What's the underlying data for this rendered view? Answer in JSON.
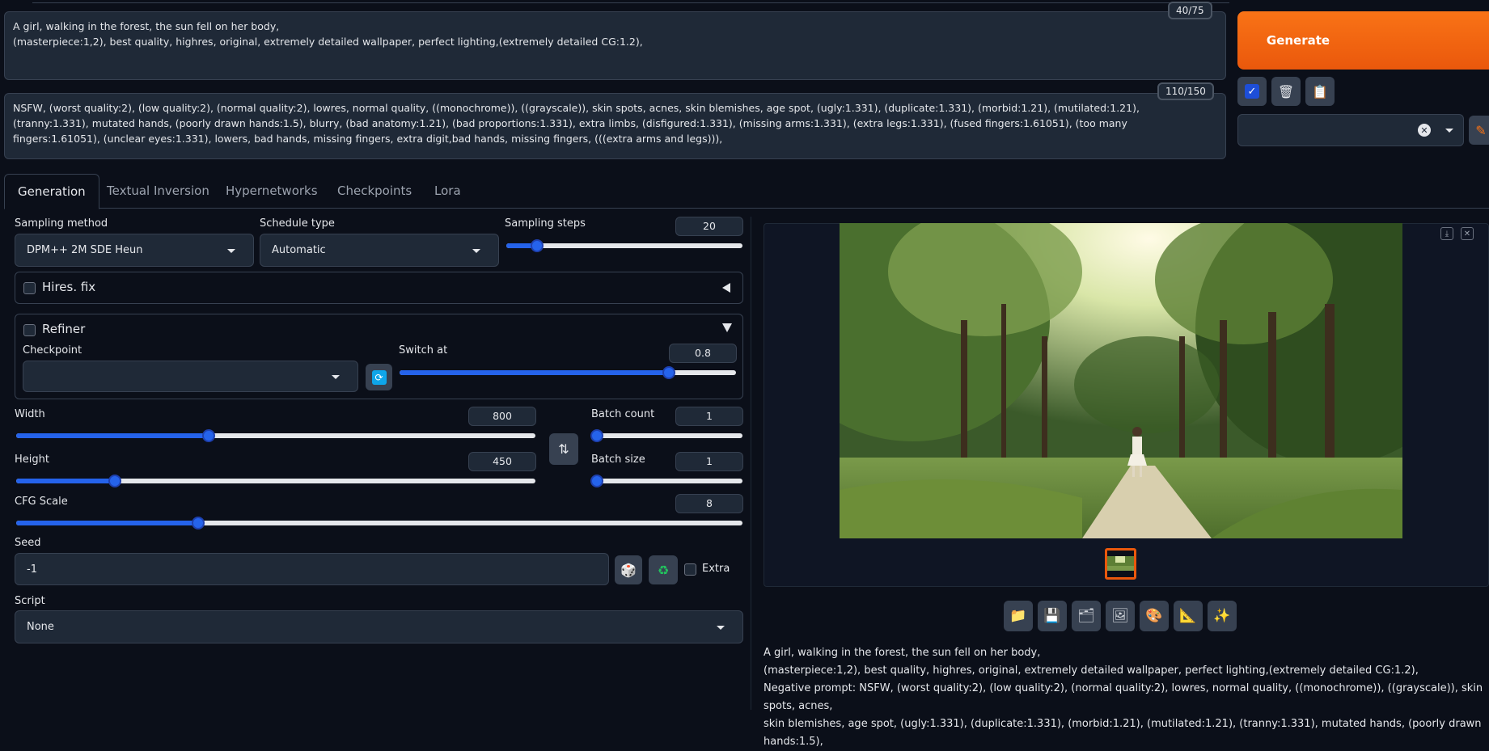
{
  "prompt": {
    "text": "A girl, walking in the forest, the sun fell on her body,\n(masterpiece:1,2), best quality, highres, original, extremely detailed wallpaper, perfect lighting,(extremely detailed CG:1.2),",
    "counter": "40/75"
  },
  "negative_prompt": {
    "text": "NSFW, (worst quality:2), (low quality:2), (normal quality:2), lowres, normal quality, ((monochrome)), ((grayscale)), skin spots, acnes, skin blemishes, age spot, (ugly:1.331), (duplicate:1.331), (morbid:1.21), (mutilated:1.21), (tranny:1.331), mutated hands, (poorly drawn hands:1.5), blurry, (bad anatomy:1.21), (bad proportions:1.331), extra limbs, (disfigured:1.331), (missing arms:1.331), (extra legs:1.331), (fused fingers:1.61051), (too many fingers:1.61051), (unclear eyes:1.331), lowers, bad hands, missing fingers, extra digit,bad hands, missing fingers, (((extra arms and legs))),",
    "counter": "110/150"
  },
  "generate_label": "Generate",
  "tabs": [
    {
      "label": "Generation"
    },
    {
      "label": "Textual Inversion"
    },
    {
      "label": "Hypernetworks"
    },
    {
      "label": "Checkpoints"
    },
    {
      "label": "Lora"
    }
  ],
  "sampling": {
    "method_label": "Sampling method",
    "method_value": "DPM++ 2M SDE Heun",
    "schedule_label": "Schedule type",
    "schedule_value": "Automatic",
    "steps_label": "Sampling steps",
    "steps_value": "20",
    "steps_fraction": 0.13
  },
  "hires": {
    "label": "Hires. fix"
  },
  "refiner": {
    "label": "Refiner",
    "checkpoint_label": "Checkpoint",
    "checkpoint_value": "",
    "switch_label": "Switch at",
    "switch_value": "0.8",
    "switch_fraction": 0.8
  },
  "width": {
    "label": "Width",
    "value": "800",
    "fraction": 0.37
  },
  "height": {
    "label": "Height",
    "value": "450",
    "fraction": 0.19
  },
  "batch_count": {
    "label": "Batch count",
    "value": "1",
    "fraction": 0.0
  },
  "batch_size": {
    "label": "Batch size",
    "value": "1",
    "fraction": 0.0
  },
  "cfg": {
    "label": "CFG Scale",
    "value": "8",
    "fraction": 0.25
  },
  "seed": {
    "label": "Seed",
    "value": "-1",
    "extra_label": "Extra"
  },
  "script": {
    "label": "Script",
    "value": "None"
  },
  "output_info": "A girl, walking in the forest, the sun fell on her body,\n(masterpiece:1,2), best quality, highres, original, extremely detailed wallpaper, perfect lighting,(extremely detailed CG:1.2),\nNegative prompt: NSFW, (worst quality:2), (low quality:2), (normal quality:2), lowres, normal quality, ((monochrome)), ((grayscale)), skin spots, acnes,\nskin blemishes, age spot, (ugly:1.331), (duplicate:1.331), (morbid:1.21), (mutilated:1.21), (tranny:1.331), mutated hands, (poorly drawn hands:1.5),",
  "colors": {
    "accent": "#2563eb",
    "generate": "#ea580c",
    "bg": "#0b0f19"
  }
}
